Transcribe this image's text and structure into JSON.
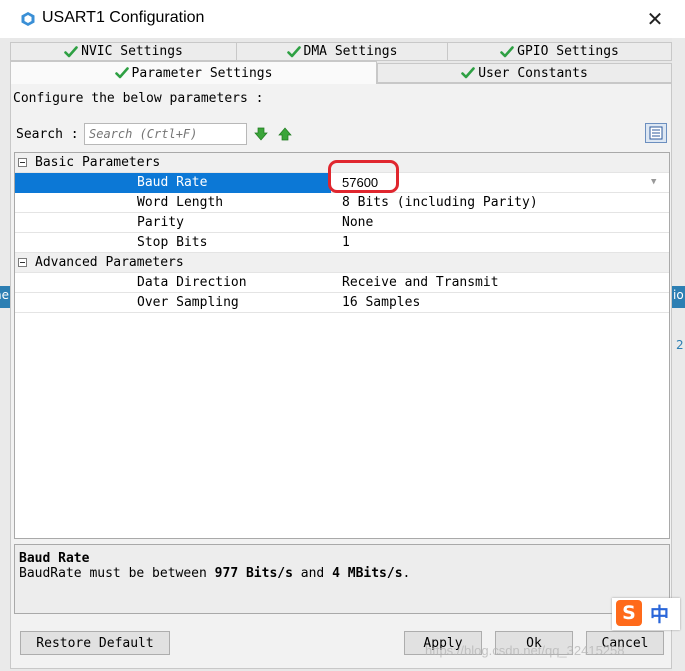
{
  "window": {
    "title": "USART1 Configuration",
    "close_glyph": "✕"
  },
  "tabs": {
    "row1": [
      {
        "label": "NVIC Settings",
        "icon": "check-icon"
      },
      {
        "label": "DMA Settings",
        "icon": "check-icon"
      },
      {
        "label": "GPIO Settings",
        "icon": "check-icon"
      }
    ],
    "row2": [
      {
        "label": "Parameter Settings",
        "icon": "check-icon",
        "active": true
      },
      {
        "label": "User Constants",
        "icon": "check-icon"
      }
    ]
  },
  "panel": {
    "configure_label": "Configure the below parameters :",
    "search_label": "Search :",
    "search_placeholder": "Search (Crtl+F)"
  },
  "groups": [
    {
      "name": "Basic Parameters",
      "params": [
        {
          "name": "Baud Rate",
          "value": "57600",
          "selected": true
        },
        {
          "name": "Word Length",
          "value": "8 Bits (including Parity)"
        },
        {
          "name": "Parity",
          "value": "None"
        },
        {
          "name": "Stop Bits",
          "value": "1"
        }
      ]
    },
    {
      "name": "Advanced Parameters",
      "params": [
        {
          "name": "Data Direction",
          "value": "Receive and Transmit"
        },
        {
          "name": "Over Sampling",
          "value": "16 Samples"
        }
      ]
    }
  ],
  "description": {
    "title": "Baud Rate",
    "text_prefix": "BaudRate must be between ",
    "min": "977 Bits/s",
    "text_mid": " and ",
    "max": "4 MBits/s",
    "text_suffix": "."
  },
  "buttons": {
    "restore": "Restore Default",
    "apply": "Apply",
    "ok": "Ok",
    "cancel": "Cancel"
  },
  "background_fragments": {
    "left": "ne",
    "right_top": "io",
    "right_mid": "2"
  },
  "ime": {
    "logo": "S",
    "mode": "中"
  },
  "watermark": "https://blog.csdn.net/qq_32415258",
  "colors": {
    "selection": "#0c78d6",
    "highlight_ring": "#e0262e",
    "check": "#2ea043"
  }
}
